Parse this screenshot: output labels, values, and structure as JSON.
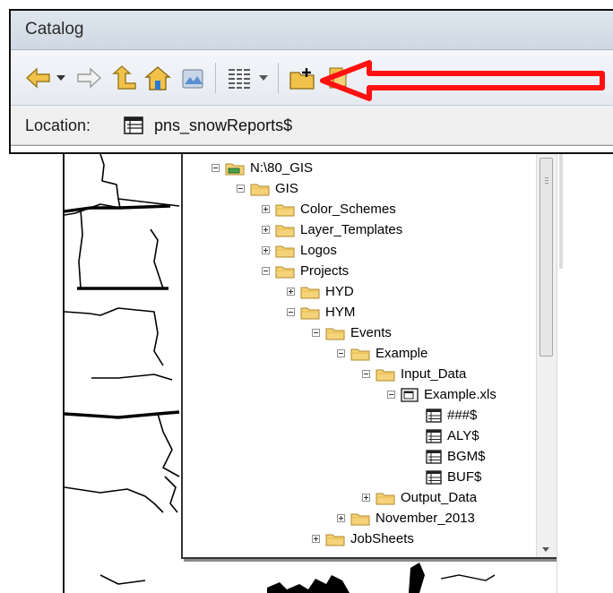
{
  "catalog": {
    "title": "Catalog",
    "location_label": "Location:",
    "location_value": "pns_snowReports$",
    "toolbar_icons": [
      "back-arrow-icon",
      "dropdown-arrow-icon",
      "forward-arrow-icon",
      "up-one-level-icon",
      "home-icon",
      "toggle-contents-icon",
      "view-options-icon",
      "view-dropdown-icon",
      "connect-to-folder-icon",
      "new-item-icon"
    ]
  },
  "annotation": {
    "arrow_color": "#ff0000"
  },
  "tree": {
    "items": [
      {
        "label": "N:\\80_GIS",
        "level": 0,
        "icon": "drive-icon",
        "expander": "minus"
      },
      {
        "label": "GIS",
        "level": 1,
        "icon": "folder-icon",
        "expander": "minus"
      },
      {
        "label": "Color_Schemes",
        "level": 2,
        "icon": "folder-icon",
        "expander": "plus"
      },
      {
        "label": "Layer_Templates",
        "level": 2,
        "icon": "folder-icon",
        "expander": "plus"
      },
      {
        "label": "Logos",
        "level": 2,
        "icon": "folder-icon",
        "expander": "plus"
      },
      {
        "label": "Projects",
        "level": 2,
        "icon": "folder-icon",
        "expander": "minus"
      },
      {
        "label": "HYD",
        "level": 3,
        "icon": "folder-icon",
        "expander": "plus"
      },
      {
        "label": "HYM",
        "level": 3,
        "icon": "folder-icon",
        "expander": "minus"
      },
      {
        "label": "Events",
        "level": 4,
        "icon": "folder-icon",
        "expander": "minus"
      },
      {
        "label": "Example",
        "level": 5,
        "icon": "folder-icon",
        "expander": "minus"
      },
      {
        "label": "Input_Data",
        "level": 6,
        "icon": "folder-icon",
        "expander": "minus"
      },
      {
        "label": "Example.xls",
        "level": 7,
        "icon": "excel-workbook-icon",
        "expander": "minus"
      },
      {
        "label": "###$",
        "level": 8,
        "icon": "table-icon",
        "expander": "none"
      },
      {
        "label": "ALY$",
        "level": 8,
        "icon": "table-icon",
        "expander": "none"
      },
      {
        "label": "BGM$",
        "level": 8,
        "icon": "table-icon",
        "expander": "none"
      },
      {
        "label": "BUF$",
        "level": 8,
        "icon": "table-icon",
        "expander": "none"
      },
      {
        "label": "Output_Data",
        "level": 6,
        "icon": "folder-icon",
        "expander": "plus"
      },
      {
        "label": "November_2013",
        "level": 5,
        "icon": "folder-icon",
        "expander": "plus"
      },
      {
        "label": "JobSheets",
        "level": 4,
        "icon": "folder-icon",
        "expander": "plus"
      }
    ]
  }
}
